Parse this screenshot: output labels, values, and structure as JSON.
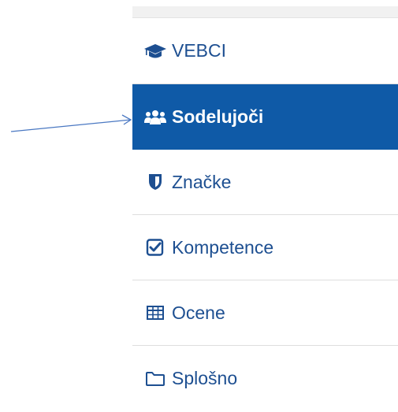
{
  "nav": {
    "items": [
      {
        "label": "VEBCI",
        "icon": "graduation-cap-icon"
      },
      {
        "label": "Sodelujoči",
        "icon": "users-icon",
        "active": true
      },
      {
        "label": "Značke",
        "icon": "shield-icon"
      },
      {
        "label": "Kompetence",
        "icon": "check-square-icon"
      },
      {
        "label": "Ocene",
        "icon": "table-icon"
      },
      {
        "label": "Splošno",
        "icon": "folder-icon"
      }
    ]
  },
  "colors": {
    "accent": "#0f5aa7",
    "link": "#1d4f91",
    "annotation_arrow": "#4a78c2"
  }
}
